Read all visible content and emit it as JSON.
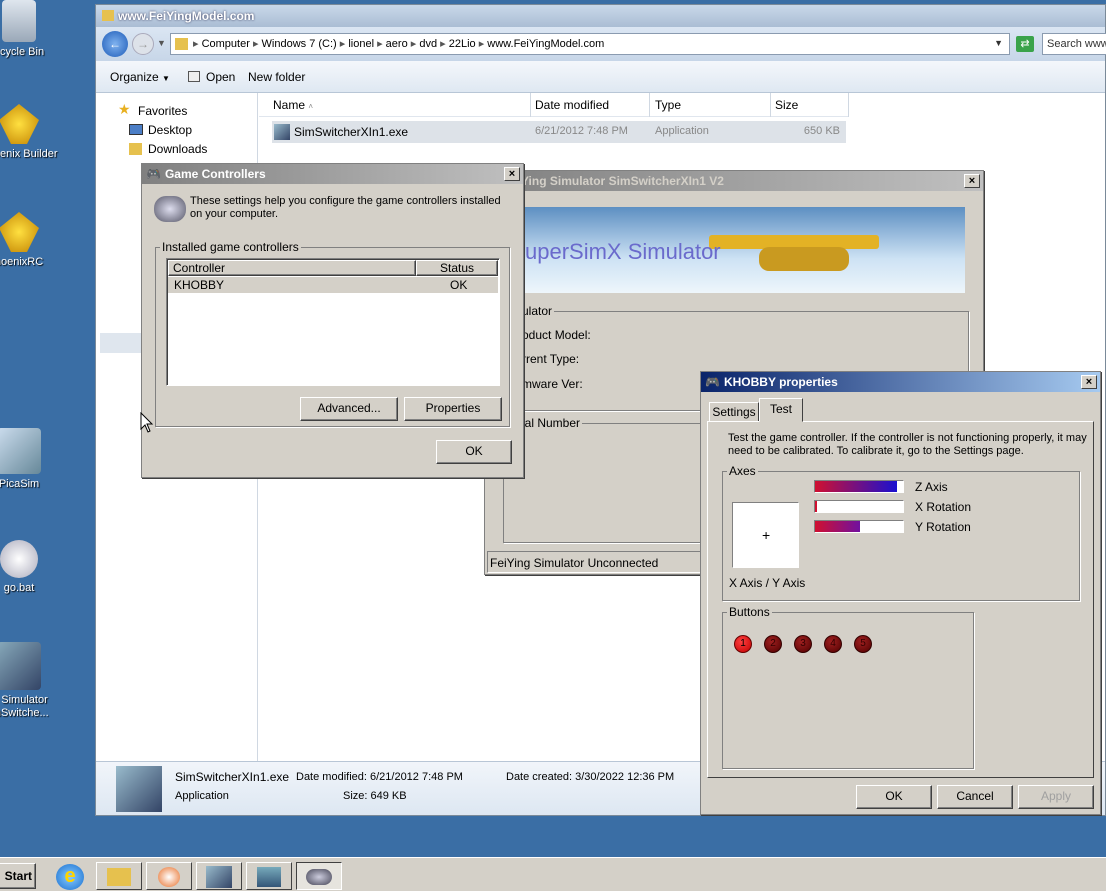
{
  "desktop": {
    "icons": [
      {
        "label": "ecycle Bin"
      },
      {
        "label": "Phoenix Builder"
      },
      {
        "label": "hoenixRC"
      },
      {
        "label": "PicaSim"
      },
      {
        "label": "go.bat"
      },
      {
        "label": "C Simulator imSwitche..."
      }
    ]
  },
  "explorer": {
    "title": "www.FeiYingModel.com",
    "breadcrumb": [
      "Computer",
      "Windows 7 (C:)",
      "lionel",
      "aero",
      "dvd",
      "22Lio",
      "www.FeiYingModel.com"
    ],
    "search_placeholder": "Search www",
    "toolbar": {
      "organize": "Organize",
      "open": "Open",
      "new_folder": "New folder"
    },
    "nav": {
      "favorites": "Favorites",
      "desktop": "Desktop",
      "downloads": "Downloads"
    },
    "columns": {
      "name": "Name",
      "date": "Date modified",
      "type": "Type",
      "size": "Size"
    },
    "file": {
      "name": "SimSwitcherXIn1.exe",
      "date": "6/21/2012 7:48 PM",
      "type": "Application",
      "size": "650 KB"
    },
    "details": {
      "name": "SimSwitcherXIn1.exe",
      "date_modified": "Date modified: 6/21/2012 7:48 PM",
      "date_created": "Date created: 3/30/2022 12:36 PM",
      "type": "Application",
      "size": "Size: 649 KB"
    }
  },
  "simswitcher": {
    "title": "Ying Simulator SimSwitcherXIn1 V2",
    "banner_text": "uperSimX Simulator",
    "group1": "ulator",
    "product_model": "oduct Model:",
    "current_type": "rrent Type:",
    "firmware": "mware Ver:",
    "serial": "ial Number",
    "status": "FeiYing Simulator Unconnected"
  },
  "game_controllers": {
    "title": "Game Controllers",
    "description": "These settings help you configure the game controllers installed on your computer.",
    "group": "Installed game controllers",
    "col_controller": "Controller",
    "col_status": "Status",
    "row_controller": "KHOBBY",
    "row_status": "OK",
    "advanced": "Advanced...",
    "properties": "Properties",
    "ok": "OK"
  },
  "props": {
    "title": "KHOBBY properties",
    "tab_settings": "Settings",
    "tab_test": "Test",
    "description": "Test the game controller.  If the controller is not functioning properly, it may need to be calibrated.  To calibrate it, go to the Settings page.",
    "axes_label": "Axes",
    "z_axis": "Z Axis",
    "x_rotation": "X Rotation",
    "y_rotation": "Y Rotation",
    "xy_label": "X Axis / Y Axis",
    "crosshair": "+",
    "buttons_label": "Buttons",
    "button_numbers": [
      "1",
      "2",
      "3",
      "4",
      "5"
    ],
    "ok": "OK",
    "cancel": "Cancel",
    "apply": "Apply"
  },
  "taskbar": {
    "start": "Start"
  },
  "colors": {
    "desktop": "#3a6ea5",
    "title_active": "#0a246a",
    "bar_fill_end": "#1a10d0",
    "bar_fill_start": "#d01030"
  }
}
